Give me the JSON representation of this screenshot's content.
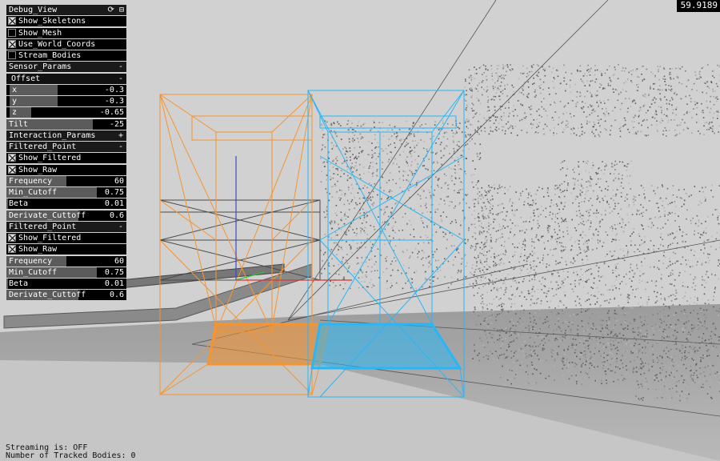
{
  "fps": "59.9189",
  "debug_view": {
    "title": "Debug_View",
    "icons": [
      "refresh-icon",
      "minimize-icon"
    ],
    "toggles": [
      {
        "label": "Show_Skeletons",
        "checked": true
      },
      {
        "label": "Show_Mesh",
        "checked": false
      },
      {
        "label": "Use_World_Coords",
        "checked": true
      },
      {
        "label": "Stream_Bodies",
        "checked": false
      }
    ]
  },
  "sensor_params": {
    "title": "Sensor_Params",
    "toggle": "-",
    "offset": {
      "title": "Offset",
      "toggle": "-",
      "sliders": [
        {
          "label": "x",
          "value": "-0.3",
          "fill": 0.4
        },
        {
          "label": "y",
          "value": "-0.3",
          "fill": 0.4
        },
        {
          "label": "z",
          "value": "-0.65",
          "fill": 0.18
        }
      ]
    },
    "tilt": {
      "label": "Tilt",
      "value": "-25",
      "fill": 0.72
    }
  },
  "interaction_params": {
    "title": "Interaction_Params",
    "toggle": "+"
  },
  "filtered_points": [
    {
      "title": "Filtered_Point",
      "toggle": "-",
      "toggles": [
        {
          "label": "Show_Filtered",
          "checked": true
        },
        {
          "label": "Show_Raw",
          "checked": true
        }
      ],
      "sliders": [
        {
          "label": "Frequency",
          "value": "60",
          "fill": 0.5
        },
        {
          "label": "Min_Cutoff",
          "value": "0.75",
          "fill": 0.75
        },
        {
          "label": "Beta",
          "value": "0.01",
          "fill": 0.01
        },
        {
          "label": "Derivate_Cuttoff",
          "value": "0.6",
          "fill": 0.6
        }
      ]
    },
    {
      "title": "Filtered_Point",
      "toggle": "-",
      "toggles": [
        {
          "label": "Show_Filtered",
          "checked": true
        },
        {
          "label": "Show_Raw",
          "checked": true
        }
      ],
      "sliders": [
        {
          "label": "Frequency",
          "value": "60",
          "fill": 0.5
        },
        {
          "label": "Min_Cutoff",
          "value": "0.75",
          "fill": 0.75
        },
        {
          "label": "Beta",
          "value": "0.01",
          "fill": 0.01
        },
        {
          "label": "Derivate_Cuttoff",
          "value": "0.6",
          "fill": 0.6
        }
      ]
    }
  ],
  "status": {
    "streaming": "Streaming is: OFF",
    "tracked": "Number of Tracked Bodies: 0"
  },
  "colors": {
    "background": "#cfcfcf",
    "floor": "#a9a9a9",
    "orange_box": "#f7942e",
    "blue_box": "#29b6f6",
    "panel_bg": "#000000",
    "slider_fill": "#5b5b5b"
  }
}
